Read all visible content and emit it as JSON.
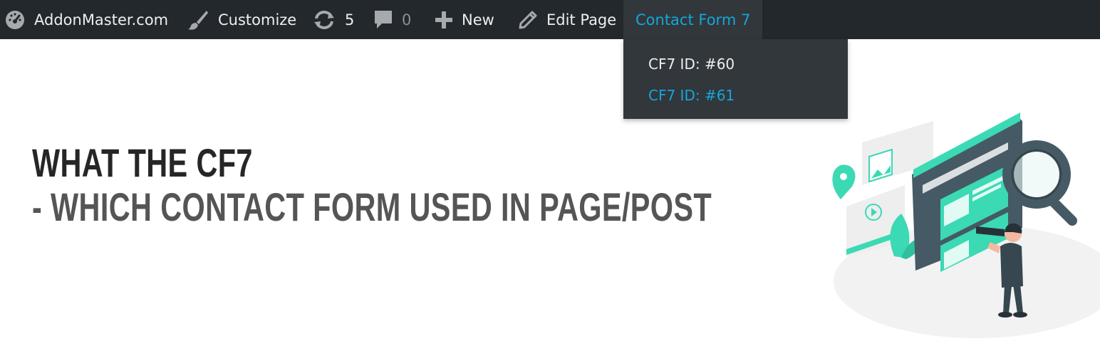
{
  "admin_bar": {
    "site_name": "AddonMaster.com",
    "customize_label": "Customize",
    "updates_count": "5",
    "comments_count": "0",
    "new_label": "New",
    "edit_label": "Edit Page",
    "contact_form_label": "Contact Form 7",
    "icons": {
      "site": "dashboard-icon",
      "customize": "paintbrush-icon",
      "updates": "refresh-icon",
      "comments": "comment-bubble-icon",
      "new": "plus-icon",
      "edit": "pencil-icon"
    }
  },
  "dropdown": {
    "items": [
      "CF7 ID: #60",
      "CF7 ID: #61"
    ]
  },
  "heading": {
    "line1": "WHAT THE CF7",
    "line2": "- WHICH CONTACT FORM USED IN PAGE/POST"
  },
  "colors": {
    "bar_background": "#23282d",
    "accent": "#14a7d8",
    "teal": "#3bd9b4"
  }
}
